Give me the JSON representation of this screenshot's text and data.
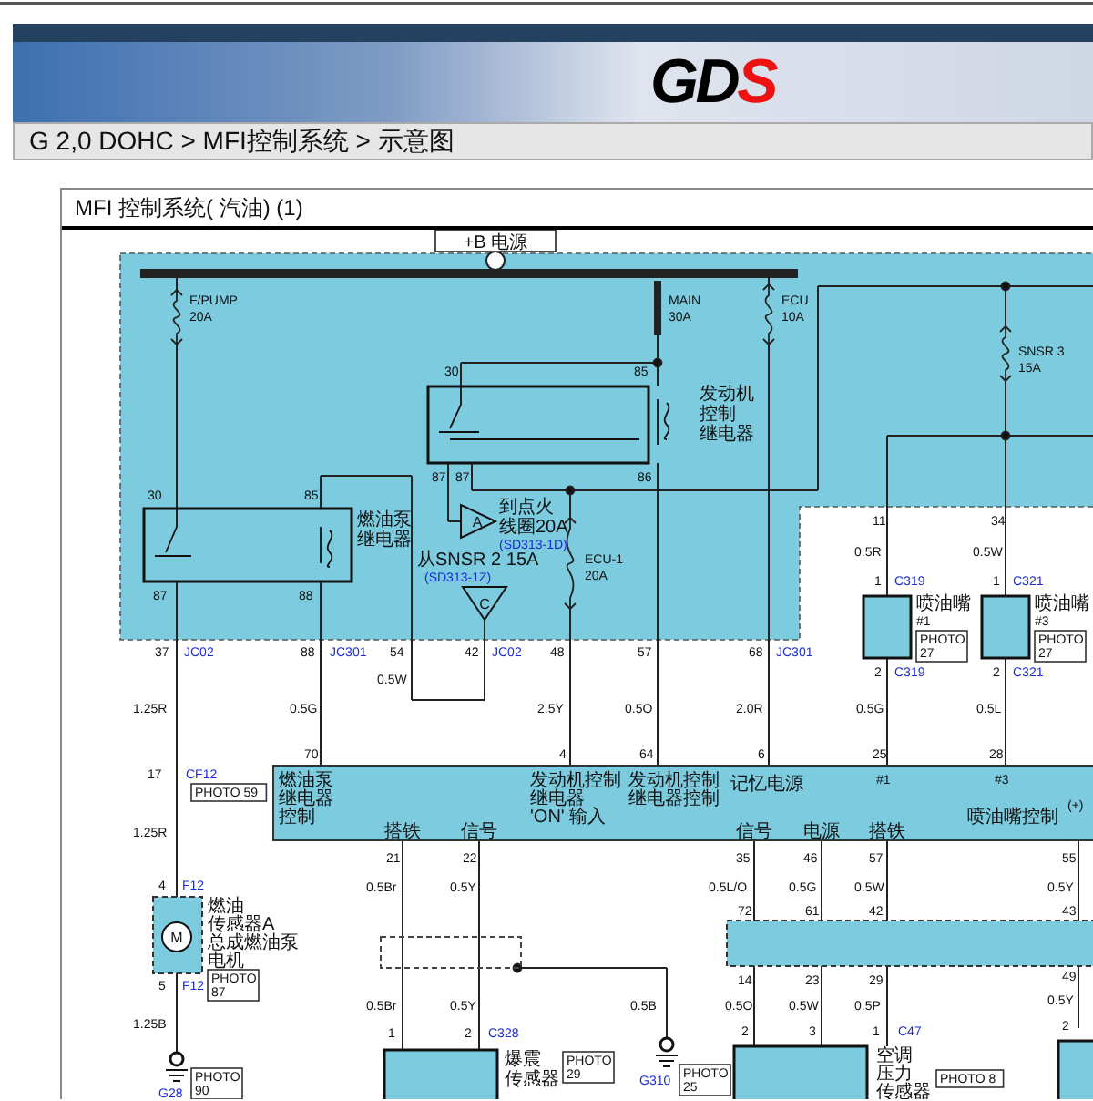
{
  "header": {
    "logo_main": "GD",
    "logo_accent": "S"
  },
  "breadcrumb": "G 2,0 DOHC > MFI控制系统 > 示意图",
  "diagram": {
    "title": "MFI 控制系统( 汽油) (1)",
    "labels": [
      {
        "text": "F/PUMP",
        "kind": "pin"
      },
      {
        "text": "20A",
        "kind": "pin"
      },
      {
        "text": "MAIN",
        "kind": "pin"
      },
      {
        "text": "30A",
        "kind": "pin"
      },
      {
        "text": "ECU",
        "kind": "pin"
      },
      {
        "text": "10A",
        "kind": "pin"
      },
      {
        "text": "SNSR 3",
        "kind": "pin"
      },
      {
        "text": "15A",
        "kind": "pin"
      },
      {
        "text": "30",
        "kind": "pin"
      },
      {
        "text": "85",
        "kind": "pin"
      },
      {
        "text": "燃油泵",
        "kind": "caption"
      },
      {
        "text": "继电器",
        "kind": "caption"
      },
      {
        "text": "87",
        "kind": "pin"
      },
      {
        "text": "88",
        "kind": "pin"
      },
      {
        "text": "30",
        "kind": "pin"
      },
      {
        "text": "85",
        "kind": "pin"
      },
      {
        "text": "发动机",
        "kind": "caption"
      },
      {
        "text": "控制",
        "kind": "caption"
      },
      {
        "text": "继电器",
        "kind": "caption"
      },
      {
        "text": "87",
        "kind": "pin"
      },
      {
        "text": "87",
        "kind": "pin"
      },
      {
        "text": "86",
        "kind": "pin"
      },
      {
        "text": "A",
        "kind": "symbol"
      },
      {
        "text": "到点火",
        "kind": "caption"
      },
      {
        "text": "线圈20A",
        "kind": "caption"
      },
      {
        "text": "(SD313-1D)",
        "kind": "connector"
      },
      {
        "text": "从SNSR 2 15A",
        "kind": "caption"
      },
      {
        "text": "(SD313-1Z)",
        "kind": "connector"
      },
      {
        "text": "C",
        "kind": "symbol"
      },
      {
        "text": "ECU-1",
        "kind": "pin"
      },
      {
        "text": "20A",
        "kind": "pin"
      },
      {
        "text": "11",
        "kind": "pin"
      },
      {
        "text": "34",
        "kind": "pin"
      },
      {
        "text": "0.5R",
        "kind": "pin"
      },
      {
        "text": "0.5W",
        "kind": "pin"
      },
      {
        "text": "1",
        "kind": "pin"
      },
      {
        "text": "C319",
        "kind": "connector"
      },
      {
        "text": "1",
        "kind": "pin"
      },
      {
        "text": "C321",
        "kind": "connector"
      },
      {
        "text": "喷油嘴",
        "kind": "caption"
      },
      {
        "text": "#1",
        "kind": "pin"
      },
      {
        "lines": [
          "PHOTO",
          "27"
        ],
        "kind": "photo"
      },
      {
        "text": "喷油嘴",
        "kind": "caption"
      },
      {
        "text": "#3",
        "kind": "pin"
      },
      {
        "lines": [
          "PHOTO",
          "27"
        ],
        "kind": "photo"
      },
      {
        "text": "2",
        "kind": "pin"
      },
      {
        "text": "C319",
        "kind": "connector"
      },
      {
        "text": "2",
        "kind": "pin"
      },
      {
        "text": "C321",
        "kind": "connector"
      },
      {
        "text": "37",
        "kind": "pin"
      },
      {
        "text": "JC02",
        "kind": "connector"
      },
      {
        "text": "88",
        "kind": "pin"
      },
      {
        "text": "JC301",
        "kind": "connector"
      },
      {
        "text": "54",
        "kind": "pin"
      },
      {
        "text": "42",
        "kind": "pin"
      },
      {
        "text": "JC02",
        "kind": "connector"
      },
      {
        "text": "48",
        "kind": "pin"
      },
      {
        "text": "57",
        "kind": "pin"
      },
      {
        "text": "68",
        "kind": "pin"
      },
      {
        "text": "JC301",
        "kind": "connector"
      },
      {
        "text": "1.25R",
        "kind": "pin"
      },
      {
        "text": "0.5G",
        "kind": "pin"
      },
      {
        "text": "0.5W",
        "kind": "pin"
      },
      {
        "text": "2.5Y",
        "kind": "pin"
      },
      {
        "text": "0.5O",
        "kind": "pin"
      },
      {
        "text": "2.0R",
        "kind": "pin"
      },
      {
        "text": "0.5G",
        "kind": "pin"
      },
      {
        "text": "0.5L",
        "kind": "pin"
      },
      {
        "text": "70",
        "kind": "pin"
      },
      {
        "text": "4",
        "kind": "pin"
      },
      {
        "text": "64",
        "kind": "pin"
      },
      {
        "text": "6",
        "kind": "pin"
      },
      {
        "text": "25",
        "kind": "pin"
      },
      {
        "text": "28",
        "kind": "pin"
      },
      {
        "text": "17",
        "kind": "pin"
      },
      {
        "text": "CF12",
        "kind": "connector"
      },
      {
        "lines": [
          "PHOTO 59"
        ],
        "kind": "photo"
      },
      {
        "text": "燃油泵",
        "kind": "caption"
      },
      {
        "text": "继电器",
        "kind": "caption"
      },
      {
        "text": "控制",
        "kind": "caption"
      },
      {
        "text": "发动机控制",
        "kind": "caption"
      },
      {
        "text": "继电器",
        "kind": "caption"
      },
      {
        "text": "'ON' 输入",
        "kind": "caption"
      },
      {
        "text": "发动机控制",
        "kind": "caption"
      },
      {
        "text": "继电器控制",
        "kind": "caption"
      },
      {
        "text": "记忆电源",
        "kind": "caption"
      },
      {
        "text": "#1",
        "kind": "pin"
      },
      {
        "text": "#3",
        "kind": "pin"
      },
      {
        "text": "喷油嘴控制",
        "kind": "caption"
      },
      {
        "text": "(+)",
        "kind": "pin"
      },
      {
        "text": "搭铁",
        "kind": "caption"
      },
      {
        "text": "信号",
        "kind": "caption"
      },
      {
        "text": "信号",
        "kind": "caption"
      },
      {
        "text": "电源",
        "kind": "caption"
      },
      {
        "text": "搭铁",
        "kind": "caption"
      },
      {
        "text": "21",
        "kind": "pin"
      },
      {
        "text": "22",
        "kind": "pin"
      },
      {
        "text": "0.5Br",
        "kind": "pin"
      },
      {
        "text": "0.5Y",
        "kind": "pin"
      },
      {
        "text": "35",
        "kind": "pin"
      },
      {
        "text": "46",
        "kind": "pin"
      },
      {
        "text": "57",
        "kind": "pin"
      },
      {
        "text": "55",
        "kind": "pin"
      },
      {
        "text": "0.5L/O",
        "kind": "pin"
      },
      {
        "text": "0.5G",
        "kind": "pin"
      },
      {
        "text": "0.5W",
        "kind": "pin"
      },
      {
        "text": "0.5Y",
        "kind": "pin"
      },
      {
        "text": "72",
        "kind": "pin"
      },
      {
        "text": "61",
        "kind": "pin"
      },
      {
        "text": "42",
        "kind": "pin"
      },
      {
        "text": "43",
        "kind": "pin"
      },
      {
        "text": "14",
        "kind": "pin"
      },
      {
        "text": "23",
        "kind": "pin"
      },
      {
        "text": "29",
        "kind": "pin"
      },
      {
        "text": "49",
        "kind": "pin"
      },
      {
        "text": "0.5O",
        "kind": "pin"
      },
      {
        "text": "0.5W",
        "kind": "pin"
      },
      {
        "text": "0.5P",
        "kind": "pin"
      },
      {
        "text": "0.5Y",
        "kind": "pin"
      },
      {
        "text": "2",
        "kind": "pin"
      },
      {
        "text": "3",
        "kind": "pin"
      },
      {
        "text": "1",
        "kind": "pin"
      },
      {
        "text": "C47",
        "kind": "connector"
      },
      {
        "text": "2",
        "kind": "pin"
      },
      {
        "text": "0.5Br",
        "kind": "pin"
      },
      {
        "text": "0.5Y",
        "kind": "pin"
      },
      {
        "text": "0.5B",
        "kind": "pin"
      },
      {
        "text": "1",
        "kind": "pin"
      },
      {
        "text": "2",
        "kind": "pin"
      },
      {
        "text": "C328",
        "kind": "connector"
      },
      {
        "text": "爆震",
        "kind": "caption"
      },
      {
        "text": "传感器",
        "kind": "caption"
      },
      {
        "lines": [
          "PHOTO",
          "29"
        ],
        "kind": "photo"
      },
      {
        "text": "G310",
        "kind": "connector"
      },
      {
        "lines": [
          "PHOTO",
          "25"
        ],
        "kind": "photo"
      },
      {
        "text": "空调",
        "kind": "caption"
      },
      {
        "text": "压力",
        "kind": "caption"
      },
      {
        "text": "传感器",
        "kind": "caption"
      },
      {
        "lines": [
          "PHOTO 8"
        ],
        "kind": "photo"
      },
      {
        "text": "4",
        "kind": "pin"
      },
      {
        "text": "F12",
        "kind": "connector"
      },
      {
        "text": "M",
        "kind": "symbol"
      },
      {
        "text": "燃油",
        "kind": "caption"
      },
      {
        "text": "传感器A",
        "kind": "caption"
      },
      {
        "text": "总成燃油泵",
        "kind": "caption"
      },
      {
        "text": "电机",
        "kind": "caption"
      },
      {
        "text": "5",
        "kind": "pin"
      },
      {
        "text": "F12",
        "kind": "connector"
      },
      {
        "lines": [
          "PHOTO",
          "87"
        ],
        "kind": "photo"
      },
      {
        "text": "1.25R",
        "kind": "pin"
      },
      {
        "text": "1.25B",
        "kind": "pin"
      },
      {
        "text": "G28",
        "kind": "connector"
      },
      {
        "lines": [
          "PHOTO",
          "90"
        ],
        "kind": "photo"
      },
      {
        "text": "+B 电源",
        "kind": "power"
      }
    ]
  }
}
